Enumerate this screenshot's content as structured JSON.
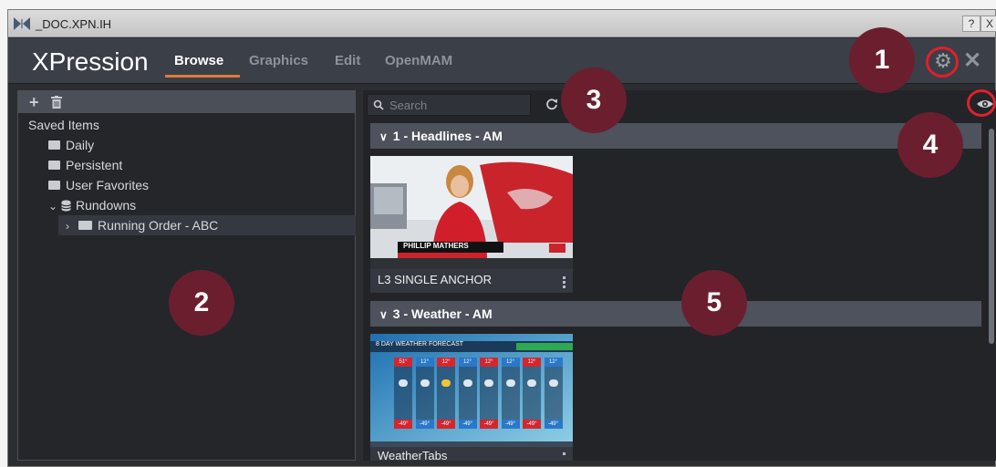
{
  "window": {
    "title": "_DOC.XPN.IH",
    "help_label": "?",
    "close_label": "X"
  },
  "app": {
    "logo": "XPression",
    "tabs": [
      {
        "label": "Browse",
        "active": true
      },
      {
        "label": "Graphics",
        "active": false
      },
      {
        "label": "Edit",
        "active": false
      },
      {
        "label": "OpenMAM",
        "active": false
      }
    ],
    "accent_color": "#e07b39"
  },
  "left_panel": {
    "toolbar": {
      "add_icon": "plus-icon",
      "delete_icon": "trash-icon"
    },
    "tree": [
      {
        "label": "Saved Items",
        "icon": "none",
        "level": 0
      },
      {
        "label": "Daily",
        "icon": "folder-icon",
        "level": 1
      },
      {
        "label": "Persistent",
        "icon": "folder-icon",
        "level": 1
      },
      {
        "label": "User Favorites",
        "icon": "folder-icon",
        "level": 1
      },
      {
        "label": "Rundowns",
        "icon": "database-icon",
        "level": 1,
        "expanded": true
      },
      {
        "label": "Running Order - ABC",
        "icon": "folder-open-icon",
        "level": 2,
        "selected": true
      }
    ]
  },
  "right_panel": {
    "search": {
      "placeholder": "Search",
      "value": ""
    },
    "groups": [
      {
        "title": "1 - Headlines - AM",
        "items": [
          {
            "label": "L3 SINGLE ANCHOR",
            "lower_third_name": "PHILLIP MATHERS"
          }
        ]
      },
      {
        "title": "3 - Weather - AM",
        "items": [
          {
            "label": "WeatherTabs",
            "banner": "8 DAY WEATHER FORECAST",
            "temps": [
              "51°",
              "12°",
              "12°",
              "12°",
              "12°",
              "12°",
              "12°",
              "12°"
            ],
            "lows": [
              "-49°",
              "-49°",
              "-49°",
              "-49°",
              "-49°",
              "-49°",
              "-49°",
              "-49°"
            ]
          }
        ]
      }
    ]
  },
  "callouts": [
    "1",
    "2",
    "3",
    "4",
    "5"
  ]
}
